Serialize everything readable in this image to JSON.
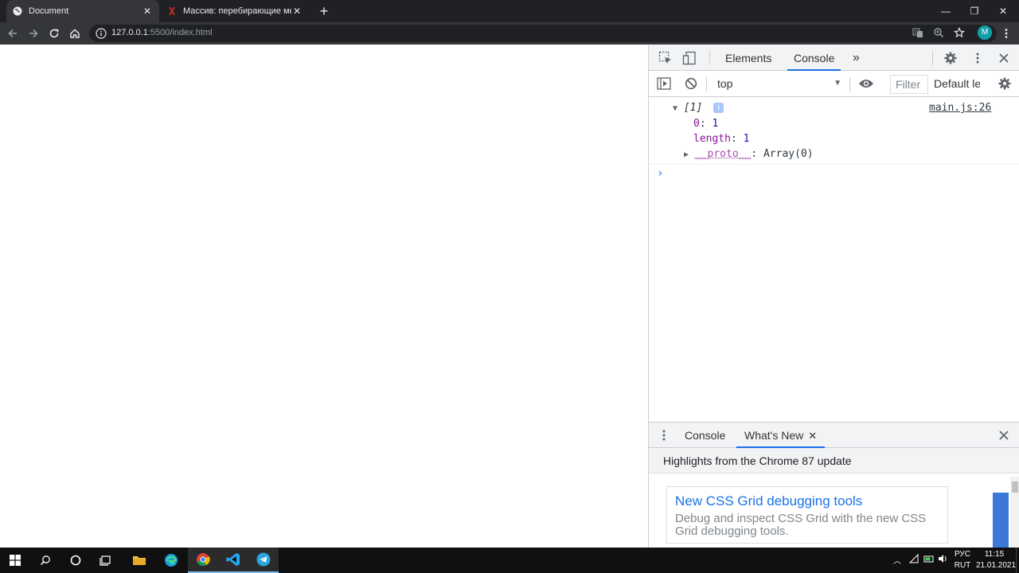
{
  "browser": {
    "tabs": [
      {
        "title": "Document",
        "active": true
      },
      {
        "title": "Массив: перебирающие методы",
        "active": false
      }
    ],
    "new_tab_label": "+",
    "window": {
      "minimize": "—",
      "restore": "❐",
      "close": "✕"
    },
    "omnibox": {
      "host": "127.0.0.1",
      "path": ":5500/index.html"
    },
    "profile_initial": "M"
  },
  "devtools": {
    "tabs": [
      "Elements",
      "Console"
    ],
    "selected_tab": "Console",
    "more_tabs": "»",
    "context": "top",
    "filter_placeholder": "Filter",
    "levels_label": "Default levels",
    "console": {
      "array_summary": "[1]",
      "info_badge": "i",
      "source": "main.js:26",
      "entries": [
        {
          "key": "0",
          "sep": ": ",
          "value": "1"
        },
        {
          "key": "length",
          "sep": ": ",
          "value": "1"
        }
      ],
      "proto": {
        "key": "__proto__",
        "sep": ": ",
        "value": "Array(0)"
      },
      "prompt": "›"
    },
    "drawer": {
      "tabs": [
        "Console",
        "What's New"
      ],
      "selected_tab": "What's New",
      "header": "Highlights from the Chrome 87 update",
      "card": {
        "title": "New CSS Grid debugging tools",
        "description": "Debug and inspect CSS Grid with the new CSS Grid debugging tools."
      }
    }
  },
  "taskbar": {
    "language": "РУС",
    "layout": "RUT",
    "time": "11:15",
    "date": "21.01.2021"
  },
  "colors": {
    "accent": "#1a73e8",
    "tabstrip": "#202124",
    "toolbar": "#35363a",
    "key_purple": "#881391",
    "number_blue": "#1a1aa6"
  }
}
